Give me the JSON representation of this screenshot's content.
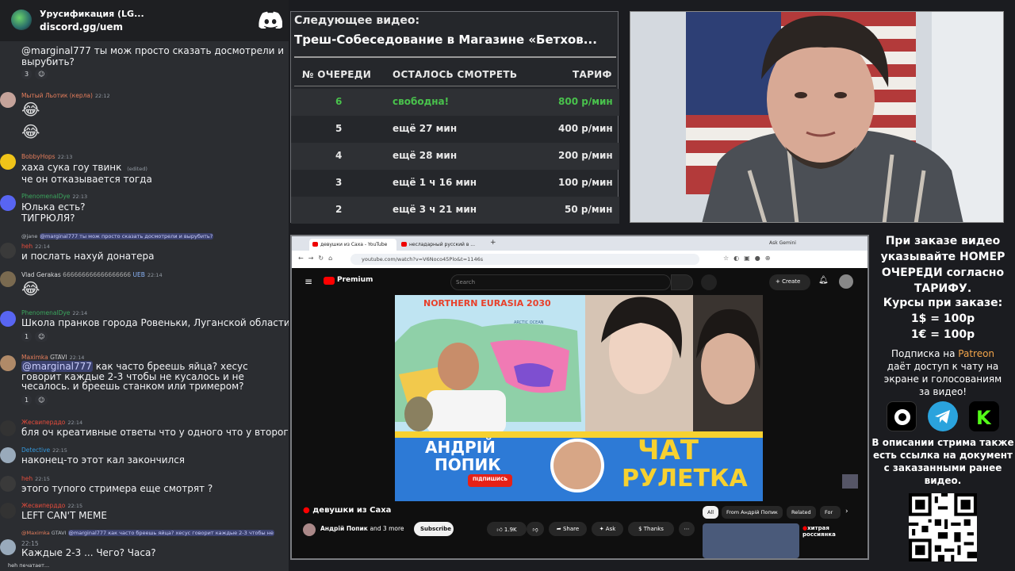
{
  "server": {
    "name": "Урусификация (LG...",
    "invite": "discord.gg/uem"
  },
  "chat": {
    "messages": [
      {
        "text": "@marginal777 ты мож просто сказать досмотрели и вырубить?",
        "react_count": "3"
      },
      {
        "user": "Мытый Льотик (керла)",
        "time": "22:12"
      },
      {
        "user": "BobbyHops",
        "time": "22:13",
        "text1": "хаха сука гоу твинк",
        "edited": "(edited)",
        "text2": "че он отказывается тогда"
      },
      {
        "user": "PhenomenalDye",
        "time": "22:13",
        "text1": "Юлька есть?",
        "text2": "ТИГРЮЛЯ?"
      },
      {
        "reply": "@marginal777 ты мож просто сказать досмотрели и вырубить?",
        "reply_user": "@jane",
        "user": "heh",
        "time": "22:14",
        "text": "и послать нахуй донатера"
      },
      {
        "user": "Vlad Gerakas",
        "time": "22:14",
        "numbers": "666666666666666666",
        "tag": "UEB"
      },
      {
        "user": "PhenomenalDye",
        "time": "22:14",
        "text": "Школа пранков города Ровеньки, Луганской области",
        "react_count": "1"
      },
      {
        "user": "Maximka",
        "tag": "GTAVI",
        "time": "22:14",
        "mention": "@marginal777",
        "text": " как часто бреешь яйца? хесус говорит каждые 2-3 чтобы не кусалось и не чесалось. и бреешь станком или тримером?",
        "react_count": "1"
      },
      {
        "user": "Жесвиперддо",
        "time": "22:14",
        "text": "бля оч креативные ответы что у одного что у второго"
      },
      {
        "user": "Detective",
        "time": "22:15",
        "text": "наконец-то этот кал закончился"
      },
      {
        "user": "heh",
        "time": "22:15",
        "text": "этого тупого стримера еще смотрят ?"
      },
      {
        "user": "Жесвиперддо",
        "time": "22:15",
        "text": "LEFT CAN'T MEME"
      },
      {
        "reply": "@marginal777 как часто бреешь яйца? хесус говорит каждые 2-3 чтобы не",
        "reply_user": "@Maximka",
        "reply_tag": "GTAVI",
        "time": "22:15",
        "text": "Каждые 2-3 ... Чего? Часа?"
      }
    ],
    "typing": "heh печатает..."
  },
  "queue": {
    "next_label": "Следующее видео:",
    "next_title": "Треш-Собеседование в Магазине «Бетхов...",
    "headers": [
      "№ ОЧЕРЕДИ",
      "ОСТАЛОСЬ СМОТРЕТЬ",
      "ТАРИФ"
    ],
    "rows": [
      {
        "num": "6",
        "left": "свободна!",
        "rate": "800 р/мин",
        "free": true
      },
      {
        "num": "5",
        "left": "ещё 27 мин",
        "rate": "400 р/мин"
      },
      {
        "num": "4",
        "left": "ещё 28 мин",
        "rate": "200 р/мин"
      },
      {
        "num": "3",
        "left": "ещё 1 ч 16 мин",
        "rate": "100 р/мин"
      },
      {
        "num": "2",
        "left": "ещё 3 ч 21 мин",
        "rate": "50 р/мин"
      }
    ]
  },
  "browser": {
    "tab1": "девушки из Саха - YouTube",
    "tab2": "несладарный русский в ...",
    "ask_gemini": "Ask Gemini",
    "url": "youtube.com/watch?v=V6Noco45Plo&t=1146s",
    "logo": "Premium",
    "search_placeholder": "Search",
    "create": "Create",
    "video": {
      "banner_top": "NORTHERN EURASIA 2030",
      "map_label": "ARCTIC OCEAN",
      "name1": "АНДРІЙ",
      "name2": "ПОПИК",
      "subscribe_yt": "ПІДПИШИСЬ",
      "chat1": "ЧАТ",
      "chat2": "РУЛЕТКА"
    },
    "title": "девушки из Саха",
    "channel": "Андрій Попик",
    "more": "and 3 more",
    "subscribe": "Subscribe",
    "likes": "1.9K",
    "share": "Share",
    "ask": "Ask",
    "thanks": "Thanks",
    "chips": [
      "All",
      "From Андрій Попик",
      "Related",
      "For"
    ],
    "rec_title1": "хитрая",
    "rec_title2": "россиянка"
  },
  "info": {
    "order_lines": [
      "При заказе видео",
      "указывайте НОМЕР",
      "ОЧЕРЕДИ согласно",
      "ТАРИФУ."
    ],
    "rates_title": "Курсы при заказе:",
    "usd": "1$ = 100р",
    "eur": "1€ = 100р",
    "sub_pre": "Подписка на ",
    "patreon": "Patreon",
    "sub_lines": [
      "даёт доступ к чату на",
      "экране и голосованиям",
      "за видео!"
    ],
    "desc_lines": [
      "В описании стрима также",
      "есть ссылка на документ",
      "с заказанными ранее",
      "видео."
    ]
  },
  "colors": {
    "free": "#49c24c",
    "patreon": "#f2a44a",
    "discord_bg": "#2b2d31",
    "accent_mention": "#c9cdfb"
  }
}
